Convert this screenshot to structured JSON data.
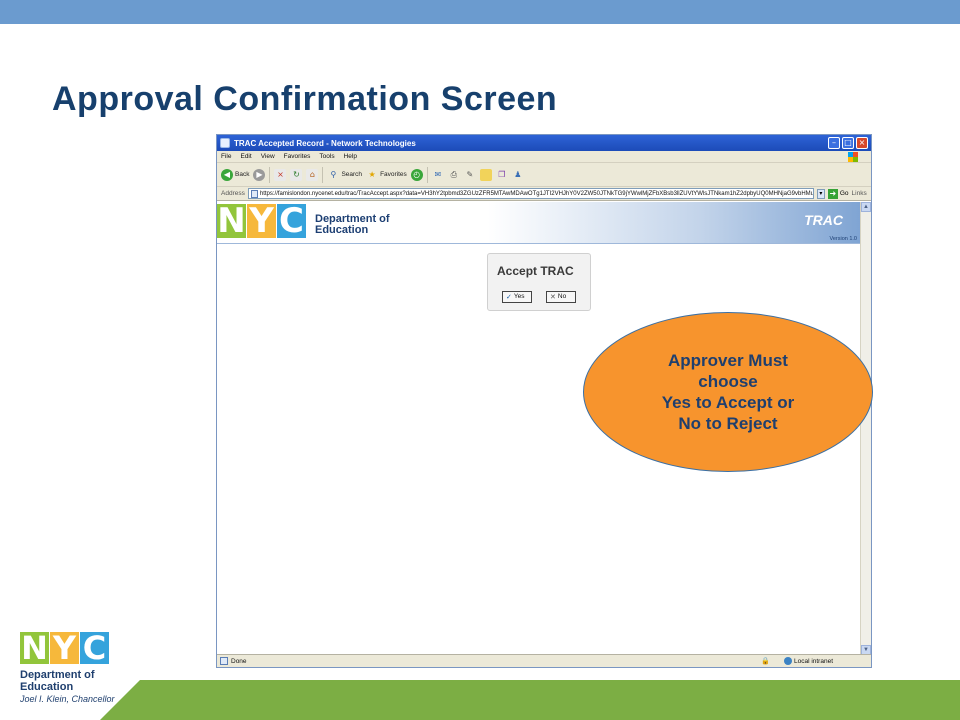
{
  "slide": {
    "title": "Approval Confirmation Screen"
  },
  "browser": {
    "window_title": "TRAC Accepted Record - Network Technologies",
    "menu": [
      "File",
      "Edit",
      "View",
      "Favorites",
      "Tools",
      "Help"
    ],
    "toolbar": {
      "back_label": "Back",
      "search_label": "Search",
      "favorites_label": "Favorites"
    },
    "address": {
      "label": "Address",
      "url": "https://famislondon.nycenet.edu/trac/TracAccept.aspx?data=VH3hY2tpbmd3ZGUzZFR5MTAwMDAwOTg1JTI2VHJhY0V2ZW50JTNkTG9jYWwlMjZFbXBsb3llZUVtYWlsJTNkam1hZ2dpbyUQ0MHNjaG9vbHMubnljLmdvdiUyNkxvY2F0aW9u",
      "go_label": "Go",
      "links_label": "Links"
    },
    "status": {
      "text": "Done",
      "zone": "Local intranet"
    }
  },
  "site": {
    "logo_letters": [
      "N",
      "Y",
      "C"
    ],
    "dept_line1": "Department of",
    "dept_line2": "Education",
    "app_name": "TRAC",
    "version": "Version 1.0"
  },
  "accept_dialog": {
    "title": "Accept TRAC",
    "yes_label": "Yes",
    "no_label": "No"
  },
  "callout": {
    "line1": "Approver Must",
    "line2": "choose",
    "line3": "Yes to Accept or",
    "line4": "No to Reject"
  },
  "footer": {
    "logo_letters": [
      "N",
      "Y",
      "C"
    ],
    "dept_line1": "Department of",
    "dept_line2": "Education",
    "chancellor": "Joel I. Klein, Chancellor"
  },
  "colors": {
    "title_blue": "#17406d",
    "top_band": "#6b9bcf",
    "callout_orange": "#f7942d",
    "footer_green": "#7cae44"
  }
}
